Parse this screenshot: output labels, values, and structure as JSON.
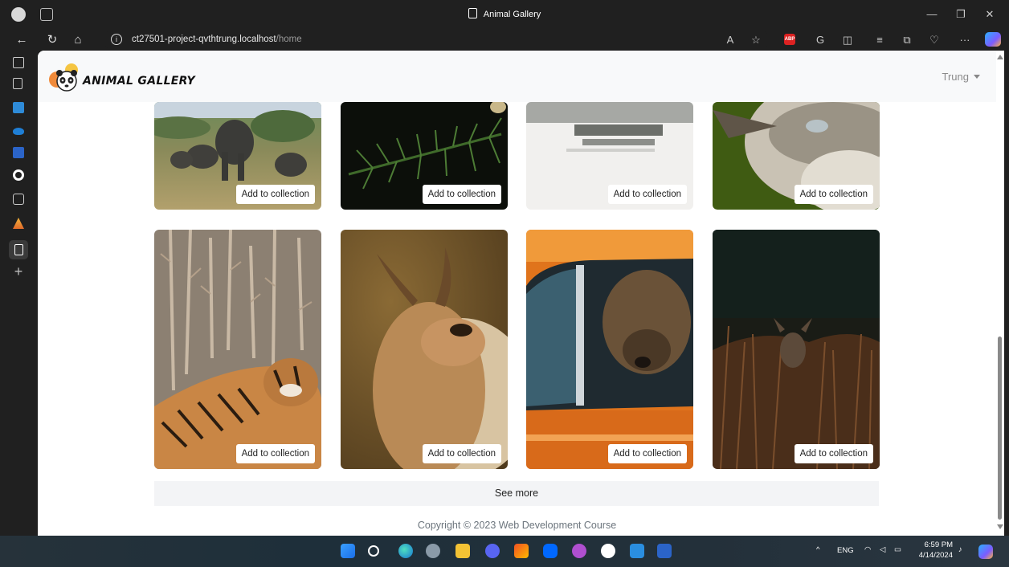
{
  "browser": {
    "window_title": "Animal Gallery",
    "url_host": "ct27501-project-qvthtrung.localhost",
    "url_path": "/home"
  },
  "navbar": {
    "brand": "ANIMAL GALLERY",
    "user": "Trung"
  },
  "gallery": {
    "cards": [
      {
        "name": "elephant-herd",
        "button": "Add to collection"
      },
      {
        "name": "pine-branch-bird",
        "button": "Add to collection"
      },
      {
        "name": "water-reflection",
        "button": "Add to collection"
      },
      {
        "name": "bird-closeup",
        "button": "Add to collection"
      },
      {
        "name": "tiger-in-grass",
        "button": "Add to collection"
      },
      {
        "name": "horned-sheep",
        "button": "Add to collection"
      },
      {
        "name": "dog-in-car",
        "button": "Add to collection"
      },
      {
        "name": "deer-in-grass",
        "button": "Add to collection"
      }
    ],
    "see_more": "See more"
  },
  "footer": {
    "copyright": "Copyright © 2023 Web Development Course"
  },
  "system_tray": {
    "language": "ENG",
    "time": "6:59 PM",
    "date": "4/14/2024"
  },
  "colors": {
    "page_bg": "#ffffff",
    "navbar_bg": "#f8f9fa",
    "chrome_bg": "#202020",
    "footer_text": "#6c757d"
  }
}
